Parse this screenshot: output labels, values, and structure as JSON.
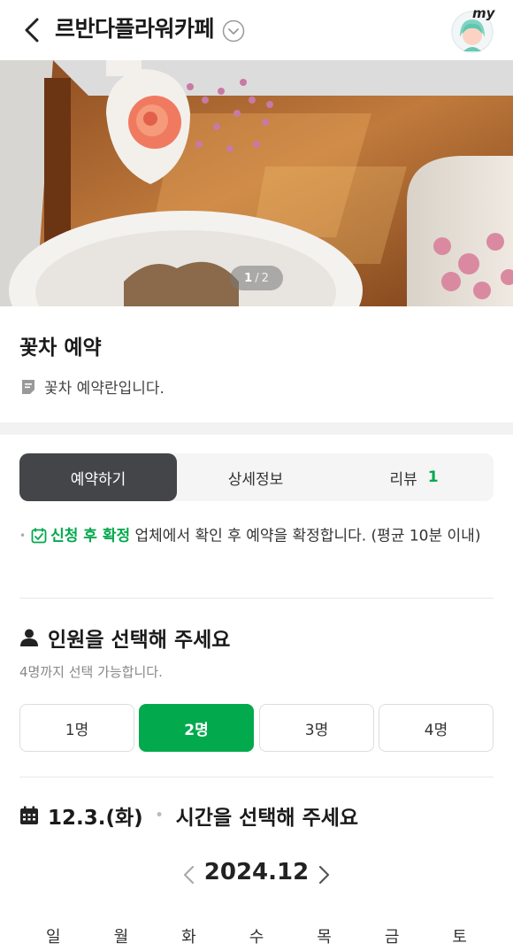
{
  "header": {
    "title": "르반다플라워카페",
    "my_label": "my",
    "icons": {
      "back": "chevron-left-icon",
      "dropdown": "chevron-down-circle-icon"
    }
  },
  "hero": {
    "page_current": "1",
    "page_sep": "/",
    "page_total": "2"
  },
  "product": {
    "title": "꽃차 예약",
    "description": "꽃차 예약란입니다."
  },
  "tabs": {
    "booking": "예약하기",
    "details": "상세정보",
    "review": "리뷰",
    "review_count": "1"
  },
  "notice": {
    "highlight": "신청 후 확정",
    "text": " 업체에서 확인 후 예약을 확정합니다. (평균 10분 이내)"
  },
  "people": {
    "title": "인원을 선택해 주세요",
    "note": "4명까지 선택 가능합니다.",
    "options": [
      "1명",
      "2명",
      "3명",
      "4명"
    ],
    "selected": "2명"
  },
  "schedule": {
    "date": "12.3.(화)",
    "title": "시간을 선택해 주세요",
    "month": "2024.12",
    "weekdays": [
      "일",
      "월",
      "화",
      "수",
      "목",
      "금",
      "토"
    ]
  },
  "colors": {
    "accent": "#03a94d",
    "tab_active": "#444549"
  }
}
